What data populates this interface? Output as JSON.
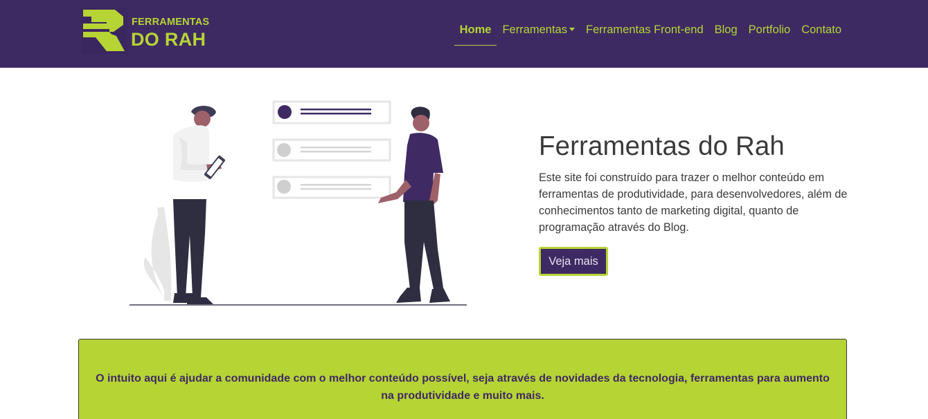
{
  "brand": {
    "line1": "FERRAMENTAS",
    "line2": "DO RAH",
    "primary_color": "#3e2a63",
    "accent_color": "#b6d434"
  },
  "nav": {
    "items": [
      {
        "label": "Home",
        "active": true
      },
      {
        "label": "Ferramentas",
        "dropdown": true
      },
      {
        "label": "Ferramentas Front-end"
      },
      {
        "label": "Blog"
      },
      {
        "label": "Portfolio"
      },
      {
        "label": "Contato"
      }
    ]
  },
  "hero": {
    "title": "Ferramentas do Rah",
    "description": "Este site foi construído para trazer o melhor conteúdo em ferramentas de produtividade, para desenvolvedores, além de conhecimentos tanto de marketing digital, quanto de programação através do Blog.",
    "button_label": "Veja mais"
  },
  "callout": {
    "text": "O intuito aqui é ajudar a comunidade com o melhor conteúdo possível, seja através de novidades da tecnologia, ferramentas para aumento na produtividade e muito mais."
  }
}
